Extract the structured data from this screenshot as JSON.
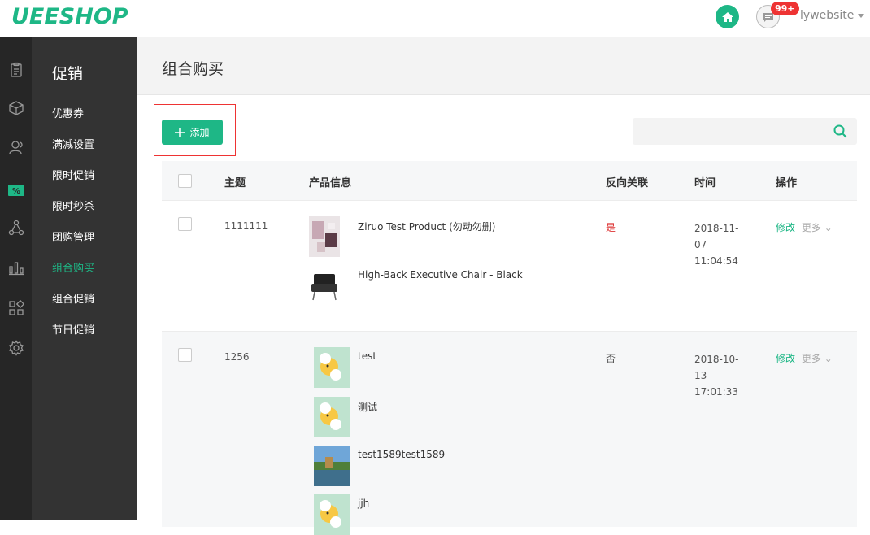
{
  "header": {
    "logo": "UEESHOP",
    "badge": "99+",
    "user": "lywebsite"
  },
  "sidebar": {
    "icons": [
      "clipboard-icon",
      "box-icon",
      "users-icon",
      "promo-icon",
      "share-icon",
      "chart-icon",
      "apps-icon",
      "gear-icon"
    ],
    "active_icon": "promo-icon",
    "title": "促销",
    "items": [
      {
        "label": "优惠券",
        "active": false
      },
      {
        "label": "满减设置",
        "active": false
      },
      {
        "label": "限时促销",
        "active": false
      },
      {
        "label": "限时秒杀",
        "active": false
      },
      {
        "label": "团购管理",
        "active": false
      },
      {
        "label": "组合购买",
        "active": true
      },
      {
        "label": "组合促销",
        "active": false
      },
      {
        "label": "节日促销",
        "active": false
      }
    ]
  },
  "page": {
    "title": "组合购买",
    "add_label": "添加",
    "search_placeholder": ""
  },
  "table": {
    "headers": {
      "subject": "主题",
      "product": "产品信息",
      "reverse": "反向关联",
      "time": "时间",
      "ops": "操作"
    },
    "rows": [
      {
        "subject": "1111111",
        "products": [
          {
            "name": "Ziruo Test Product (勿动勿删)",
            "thumb": "clothes"
          },
          {
            "name": "High-Back Executive Chair - Black",
            "thumb": "chair"
          }
        ],
        "reverse": "是",
        "time_lines": [
          "2018-11-",
          "07",
          "11:04:54"
        ],
        "edit": "修改",
        "more": "更多"
      },
      {
        "subject": "1256",
        "products": [
          {
            "name": "test",
            "thumb": "cartoon"
          },
          {
            "name": "测试",
            "thumb": "cartoon"
          },
          {
            "name": "test1589test1589",
            "thumb": "landscape"
          },
          {
            "name": "jjh",
            "thumb": "cartoon"
          }
        ],
        "reverse": "否",
        "time_lines": [
          "2018-10-",
          "13",
          "17:01:33"
        ],
        "edit": "修改",
        "more": "更多"
      }
    ]
  },
  "colors": {
    "accent": "#1eb786",
    "danger": "#dd3333",
    "sidebar_dark": "#262626",
    "submenu": "#333333"
  }
}
